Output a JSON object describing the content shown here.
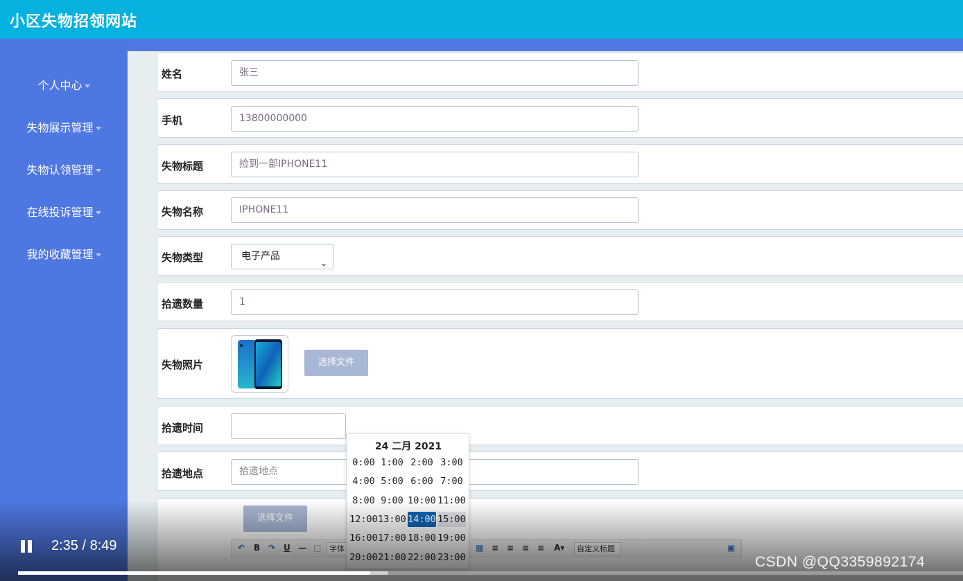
{
  "header": {
    "title": "小区失物招领网站"
  },
  "sidebar": {
    "items": [
      {
        "label": "个人中心"
      },
      {
        "label": "失物展示管理"
      },
      {
        "label": "失物认领管理"
      },
      {
        "label": "在线投诉管理"
      },
      {
        "label": "我的收藏管理"
      }
    ]
  },
  "form": {
    "name": {
      "label": "姓名",
      "value": "张三"
    },
    "phone": {
      "label": "手机",
      "value": "13800000000"
    },
    "title": {
      "label": "失物标题",
      "value": "捡到一部IPHONE11"
    },
    "item_name": {
      "label": "失物名称",
      "value": "IPHONE11"
    },
    "type": {
      "label": "失物类型",
      "selected": "电子产品"
    },
    "quantity": {
      "label": "拾遗数量",
      "value": "1"
    },
    "photo": {
      "label": "失物照片",
      "button": "选择文件"
    },
    "time": {
      "label": "拾遗时间",
      "value": ""
    },
    "place": {
      "label": "拾遗地点",
      "placeholder": "拾遗地点"
    },
    "editor": {
      "button": "选择文件",
      "font_select": "字体",
      "heading_select": "自定义标题"
    }
  },
  "datepicker": {
    "header": "24 二月 2021",
    "hours": [
      "0:00",
      "1:00",
      "2:00",
      "3:00",
      "4:00",
      "5:00",
      "6:00",
      "7:00",
      "8:00",
      "9:00",
      "10:00",
      "11:00",
      "12:00",
      "13:00",
      "14:00",
      "15:00",
      "16:00",
      "17:00",
      "18:00",
      "19:00",
      "20:00",
      "21:00",
      "22:00",
      "23:00"
    ],
    "active": "14:00",
    "hover": "15:00"
  },
  "video": {
    "time": "2:35 / 8:49",
    "progress_fraction": 0.373,
    "buffered_fraction": 0.392
  },
  "watermark": "CSDN @QQ3359892174",
  "colors": {
    "topbar": "#04b1df",
    "sidebar": "#4f77e1",
    "active_hour": "#0f66b4"
  }
}
